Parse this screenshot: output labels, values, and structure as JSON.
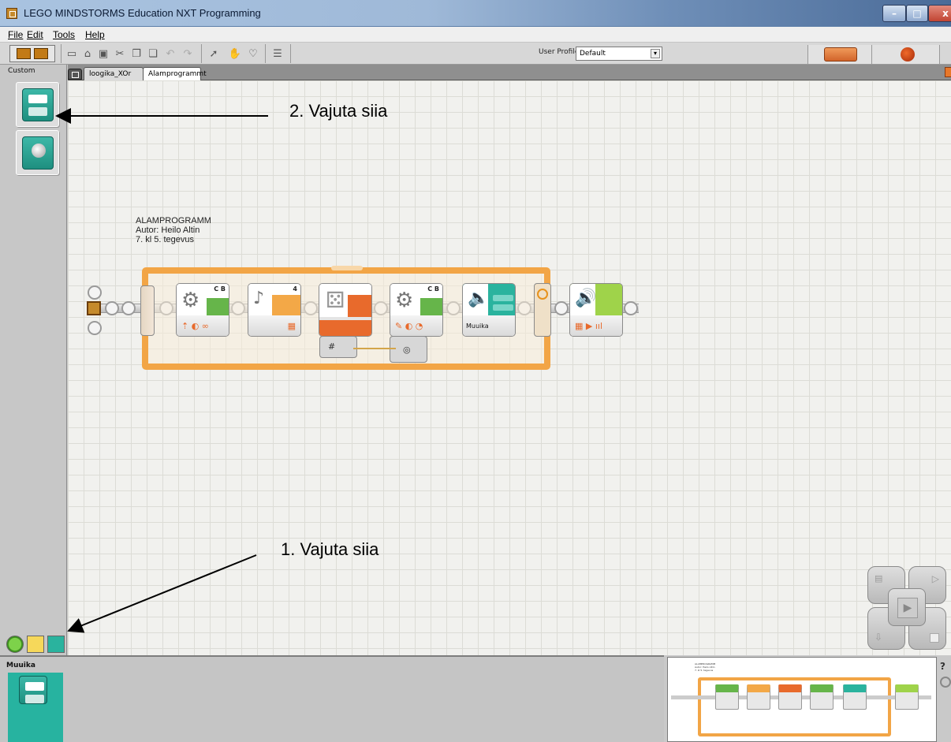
{
  "window": {
    "title": "LEGO MINDSTORMS Education NXT Programming",
    "min_glyph": "–",
    "max_glyph": "□",
    "close_glyph": "x"
  },
  "menu": {
    "items": [
      "File",
      "Edit",
      "Tools",
      "Help"
    ]
  },
  "toolbar": {
    "user_profile_label": "User Profile:",
    "user_profile_value": "Default",
    "dropdown_glyph": "▾",
    "icons": [
      "new-file-icon",
      "open-file-icon",
      "save-icon",
      "cut-icon",
      "copy-icon",
      "paste-icon",
      "undo-icon",
      "redo-icon",
      "pointer-icon",
      "pan-hand-icon",
      "comment-icon",
      "custom-palette-icon"
    ]
  },
  "palette": {
    "label": "Custom"
  },
  "canvas": {
    "tabs": [
      "loogika_XOr",
      "Alamprogrammt"
    ],
    "comment_lines": [
      "ALAMPROGRAMM",
      "Autor: Heilo Altin",
      "7. kl 5. tegevus"
    ],
    "blocks": [
      {
        "name": "move-block-1",
        "port": "C B",
        "color": "#66b54a",
        "icon": "gears-icon",
        "label": ""
      },
      {
        "name": "sound-sensor-block",
        "port": "4",
        "color": "#f3a847",
        "icon": "sound-sensor-icon",
        "label": ""
      },
      {
        "name": "random-block",
        "port": "",
        "color": "#e86a2c",
        "icon": "dice-icon",
        "label": ""
      },
      {
        "name": "move-block-2",
        "port": "C B",
        "color": "#66b54a",
        "icon": "gears-icon",
        "label": ""
      },
      {
        "name": "my-block-muuika",
        "port": "",
        "color": "#2ab39e",
        "icon": "speaker-icon",
        "label": "Muuika"
      },
      {
        "name": "sound-block",
        "port": "",
        "color": "#9fd34a",
        "icon": "speaker-icon",
        "label": ""
      }
    ]
  },
  "annotations": {
    "step2": "2. Vajuta siia",
    "step1": "1. Vajuta siia"
  },
  "config_panel": {
    "title": "Muuika"
  },
  "minimap": {
    "comment_lines": [
      "ALAMPROGRAMM",
      "Autor: Heilo Altin",
      "7. kl 5. tegevus"
    ],
    "help_glyph": "?"
  },
  "colors": {
    "loop": "#f2a546",
    "move": "#66b54a",
    "sensor": "#f3a847",
    "random": "#e86a2c",
    "myblock": "#2ab39e",
    "sound": "#9fd34a"
  }
}
